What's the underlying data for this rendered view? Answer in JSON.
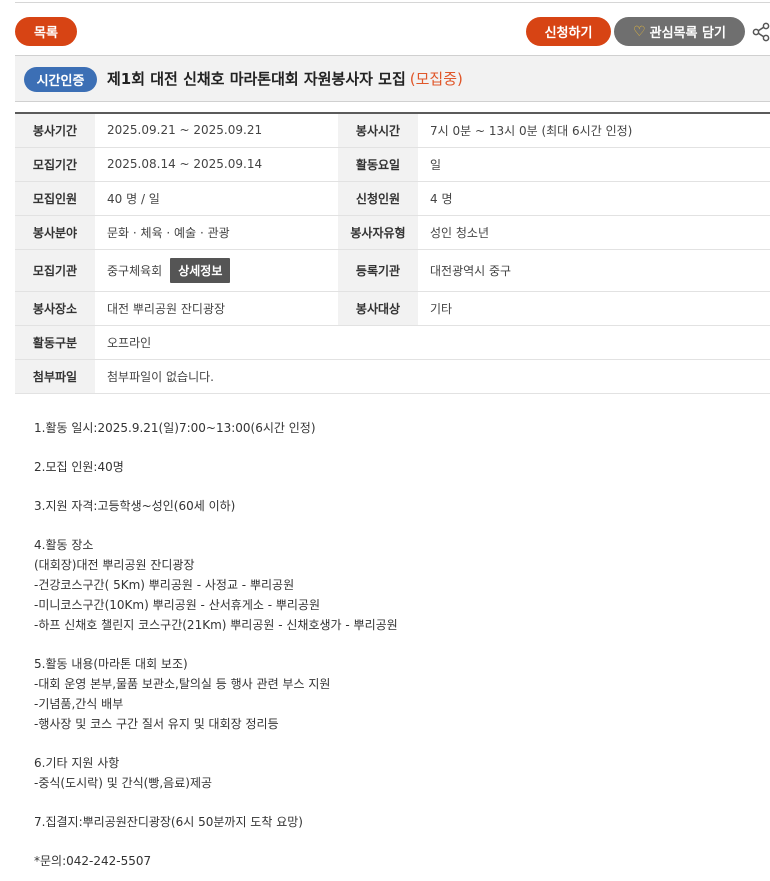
{
  "top_buttons": {
    "list": "목록",
    "apply": "신청하기",
    "favorite": "관심목록 담기"
  },
  "title": {
    "badge": "시간인증",
    "text": "제1회 대전 신채호 마라톤대회 자원봉사자 모집",
    "status": "(모집중)"
  },
  "info": {
    "service_period_label": "봉사기간",
    "service_period": "2025.09.21 ~ 2025.09.21",
    "service_time_label": "봉사시간",
    "service_time": "7시 0분 ~ 13시 0분 (최대 6시간 인정)",
    "recruit_period_label": "모집기간",
    "recruit_period": "2025.08.14 ~ 2025.09.14",
    "activity_day_label": "활동요일",
    "activity_day": "일",
    "recruit_count_label": "모집인원",
    "recruit_count": "40 명 / 일",
    "applied_count_label": "신청인원",
    "applied_count": "4 명",
    "field_label": "봉사분야",
    "field": "문화 · 체육 · 예술 · 관광",
    "volunteer_type_label": "봉사자유형",
    "volunteer_type": "성인 청소년",
    "org_label": "모집기관",
    "org": "중구체육회",
    "org_detail_button": "상세정보",
    "reg_org_label": "등록기관",
    "reg_org": "대전광역시 중구",
    "place_label": "봉사장소",
    "place": "대전 뿌리공원 잔디광장",
    "target_label": "봉사대상",
    "target": "기타",
    "activity_type_label": "활동구분",
    "activity_type": "오프라인",
    "attachment_label": "첨부파일",
    "attachment": "첨부파일이 없습니다."
  },
  "content": {
    "l1": "1.활동 일시:2025.9.21(일)7:00~13:00(6시간 인정)",
    "l2": "2.모집 인원:40명",
    "l3": "3.지원 자격:고등학생~성인(60세 이하)",
    "l4": "4.활동 장소",
    "l5": "(대회장)대전 뿌리공원 잔디광장",
    "l6": "-건강코스구간( 5Km) 뿌리공원 - 사정교 - 뿌리공원",
    "l7": "-미니코스구간(10Km) 뿌리공원 - 산서휴게소 - 뿌리공원",
    "l8": "-하프 신채호 챌린지 코스구간(21Km) 뿌리공원 - 신채호생가 - 뿌리공원",
    "l9": "5.활동 내용(마라톤 대회 보조)",
    "l10": "-대회 운영 본부,물품 보관소,탈의실 등 행사 관련 부스 지원",
    "l11": "-기념품,간식 배부",
    "l12": "-행사장 및 코스 구간 질서 유지 및 대회장 정리등",
    "l13": "6.기타 지원 사항",
    "l14": "-중식(도시락) 및 간식(빵,음료)제공",
    "l15": "7.집결지:뿌리공원잔디광장(6시 50분까지 도착 요망)",
    "l16": "*문의:042-242-5507"
  },
  "colors": {
    "accent_orange": "#d74414",
    "badge_blue": "#3c6fb5",
    "favorite_gray": "#6f6f6f",
    "status_orange": "#e0572a"
  },
  "icons": {
    "favorite": "heart-icon",
    "share": "share-icon"
  }
}
